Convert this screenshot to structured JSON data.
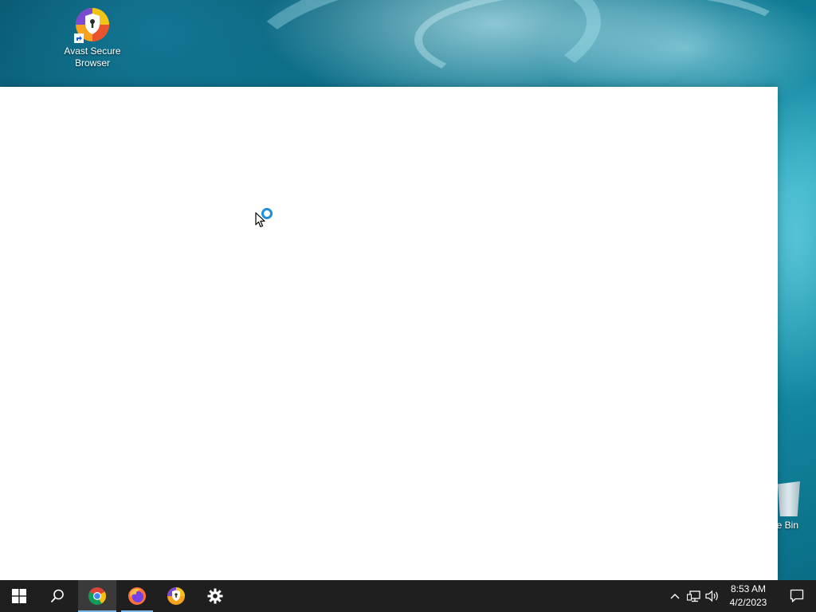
{
  "desktop": {
    "icons": [
      {
        "label": "Avast Secure Browser"
      },
      {
        "label": "le Bin"
      }
    ]
  },
  "taskbar": {
    "start": {
      "icon": "windows-logo-icon"
    },
    "search": {
      "icon": "search-icon"
    },
    "apps": [
      {
        "icon": "chrome-icon",
        "active": true
      },
      {
        "icon": "firefox-icon",
        "running": true
      },
      {
        "icon": "avast-browser-icon"
      },
      {
        "icon": "gear-icon"
      }
    ],
    "tray": {
      "icons": [
        "chevron-up-icon",
        "network-icon",
        "volume-icon"
      ],
      "time": "8:53 AM",
      "date": "4/2/2023"
    },
    "notifications": {
      "icon": "action-center-icon"
    }
  },
  "colors": {
    "taskbar": "#1f1f1f",
    "active_indicator": "#78b7e6",
    "busy_ring": "#1e90d8"
  }
}
